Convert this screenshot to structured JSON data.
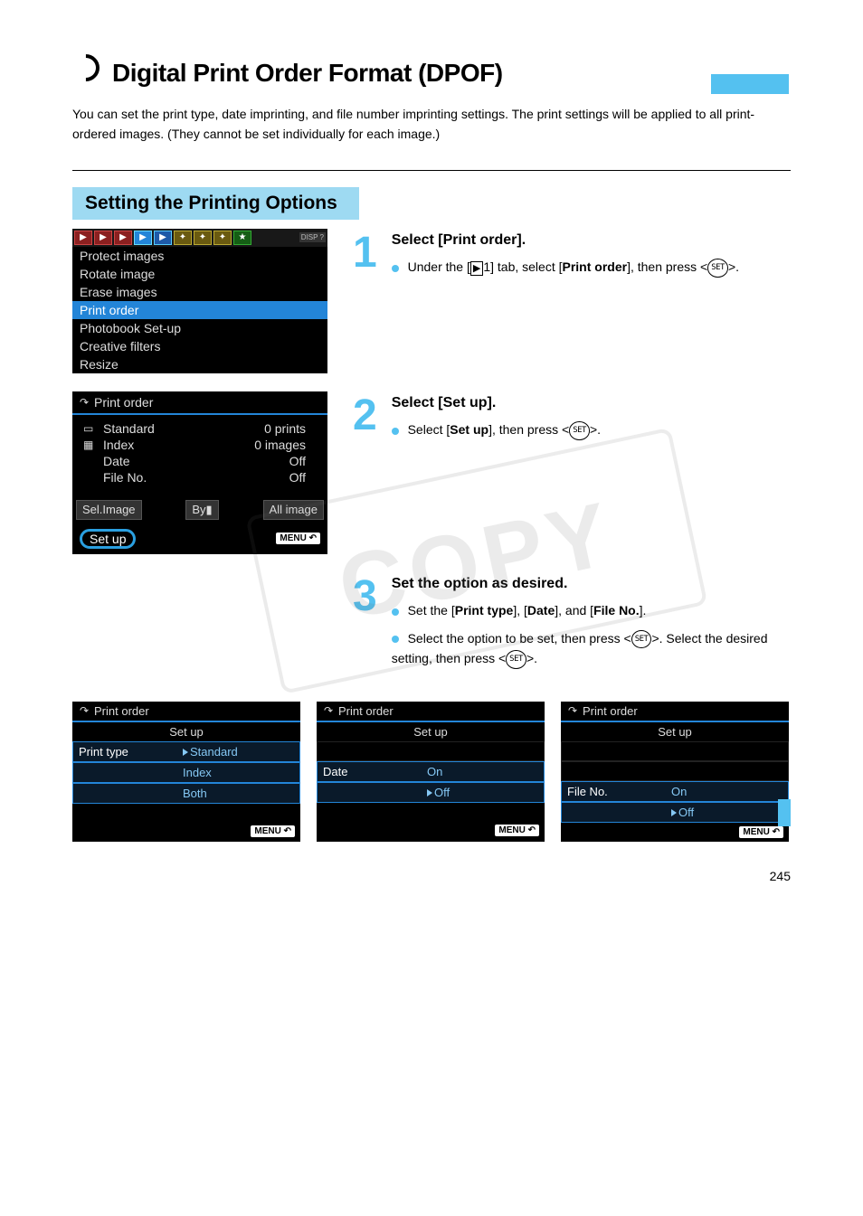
{
  "watermark": "COPY",
  "header": {
    "title": "Digital Print Order Format (DPOF)"
  },
  "intro": "You can set the print type, date imprinting, and file number imprinting settings. The print settings will be applied to all print-ordered images. (They cannot be set individually for each image.)",
  "section_title": "Setting the Printing Options",
  "steps": {
    "s1": {
      "title": "Select [Print order].",
      "line1a": "Under the [",
      "line1_icon": "▶",
      "line1b": "1] tab, select [",
      "line1_bold": "Print order",
      "line1c": "], then press <",
      "line1_set": "SET",
      "line1d": ">."
    },
    "s2": {
      "title": "Select [Set up].",
      "line1a": "Select [",
      "line1_bold": "Set up",
      "line1b": "], then press <",
      "line1_set": "SET",
      "line1c": ">."
    },
    "s3": {
      "title": "Set the option as desired.",
      "b1a": "Set the [",
      "b1_k1": "Print type",
      "b1b": "], [",
      "b1_k2": "Date",
      "b1c": "], and [",
      "b1_k3": "File No.",
      "b1d": "].",
      "b2a": "Select the option to be set, then press <",
      "b2_set": "SET",
      "b2b": ">. Select the desired setting, then press <",
      "b2_set2": "SET",
      "b2c": ">."
    }
  },
  "lcd_menu": {
    "items": [
      "Protect images",
      "Rotate image",
      "Erase images",
      "Print order",
      "Photobook Set-up",
      "Creative filters",
      "Resize"
    ],
    "disp": "DISP ?"
  },
  "lcd_po": {
    "header": "Print order",
    "rows": [
      {
        "icon": "▭",
        "k": "Standard",
        "v": "0 prints"
      },
      {
        "icon": "▦",
        "k": "Index",
        "v": "0 images"
      },
      {
        "icon": "",
        "k": "Date",
        "v": "Off"
      },
      {
        "icon": "",
        "k": "File No.",
        "v": "Off"
      }
    ],
    "btns": [
      "Sel.Image",
      "By▮",
      "All image"
    ],
    "setup": "Set up",
    "menu": "MENU"
  },
  "setup_screens": [
    {
      "header": "Print order",
      "title": "Set up",
      "rows": [
        {
          "label": "Print type",
          "val": "Standard",
          "hl": true,
          "sel": true
        },
        {
          "label": "",
          "val": "Index",
          "hl": true
        },
        {
          "label": "",
          "val": "Both",
          "hl": true
        }
      ],
      "menu": "MENU"
    },
    {
      "header": "Print order",
      "title": "Set up",
      "rows": [
        {
          "label": "Date",
          "val": "On",
          "hl": true
        },
        {
          "label": "",
          "val": "Off",
          "hl": true,
          "sel": true
        }
      ],
      "menu": "MENU"
    },
    {
      "header": "Print order",
      "title": "Set up",
      "rows": [
        {
          "label": "File No.",
          "val": "On",
          "hl": true
        },
        {
          "label": "",
          "val": "Off",
          "hl": true,
          "sel": true
        }
      ],
      "menu": "MENU"
    }
  ],
  "page_number": "245"
}
